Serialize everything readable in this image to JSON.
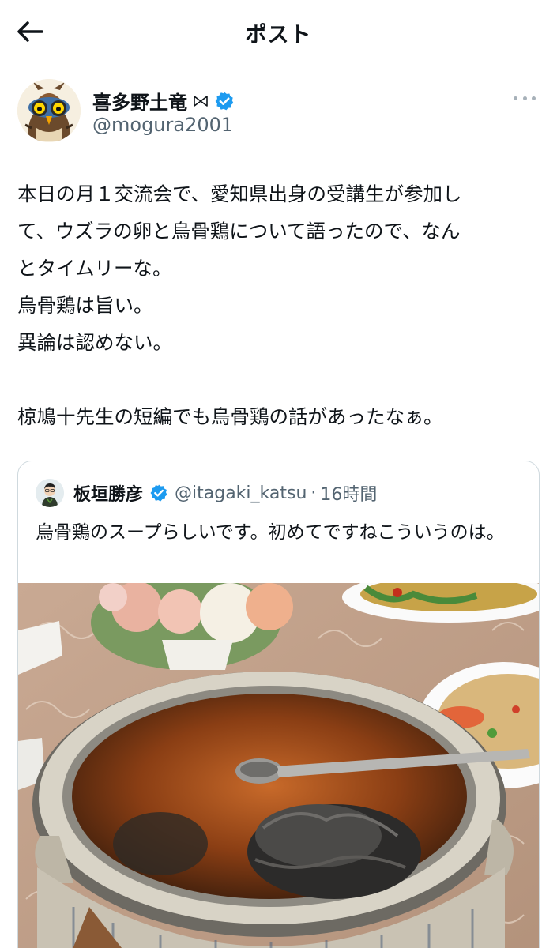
{
  "header": {
    "title": "ポスト",
    "back_icon": "arrow-left-icon"
  },
  "post": {
    "author": {
      "display_name": "喜多野土竜",
      "name_suffix_icon": "bowtie-icon",
      "verified": true,
      "verified_color": "#1d9bf0",
      "handle": "@mogura2001"
    },
    "more_icon": "more-horizontal-icon",
    "text_lines": [
      "本日の月１交流会で、愛知県出身の受講生が参加し",
      "て、ウズラの卵と烏骨鶏について語ったので、なん",
      "とタイムリーな。",
      "烏骨鶏は旨い。",
      "異論は認めない。",
      "",
      "椋鳩十先生の短編でも烏骨鶏の話があったなぁ。"
    ]
  },
  "quote": {
    "author": {
      "display_name": "板垣勝彦",
      "verified": true,
      "handle": "@itagaki_katsu",
      "separator": "·",
      "time": "16時間"
    },
    "text": "烏骨鶏のスープらしいです。初めてですねこういうのは。",
    "image_icon": "photo-silkie-chicken-soup"
  },
  "colors": {
    "text": "#0f1419",
    "secondary": "#536471",
    "border": "#cfd9de",
    "accent": "#1d9bf0"
  }
}
